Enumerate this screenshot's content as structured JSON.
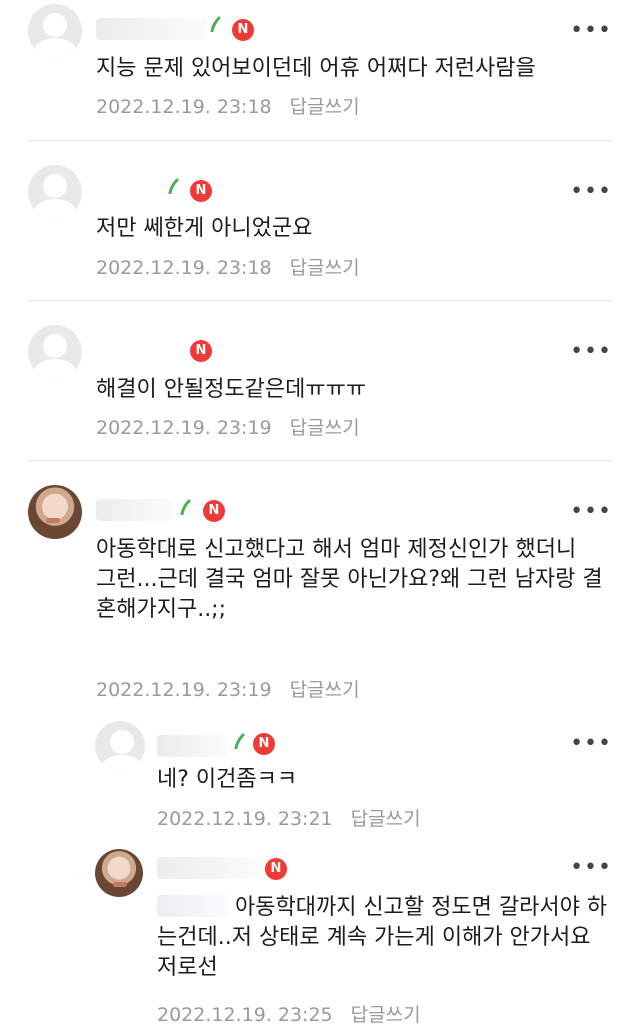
{
  "comments": [
    {
      "text": "지능 문제 있어보이던데 어휴 어쩌다 저런사람을",
      "date": "2022.12.19. 23:18",
      "reply_label": "답글쓰기",
      "badge": "N"
    },
    {
      "text": "저만 쎄한게 아니었군요",
      "date": "2022.12.19. 23:18",
      "reply_label": "답글쓰기",
      "badge": "N"
    },
    {
      "text": "해결이 안될정도같은데ㅠㅠㅠ",
      "date": "2022.12.19. 23:19",
      "reply_label": "답글쓰기",
      "badge": "N"
    },
    {
      "text": "아동학대로 신고했다고 해서 엄마 제정신인가 했더니\n그런...근데 결국 엄마 잘못 아닌가요?왜 그런 남자랑 결혼해가지구..;;",
      "date": "2022.12.19. 23:19",
      "reply_label": "답글쓰기",
      "badge": "N"
    }
  ],
  "replies": [
    {
      "text": "네? 이건좀ㅋㅋ",
      "date": "2022.12.19. 23:21",
      "reply_label": "답글쓰기",
      "badge": "N"
    },
    {
      "text": "아동학대까지 신고할 정도면 갈라서야 하는건데..저 상태로 계속 가는게 이해가 안가서요 저로선",
      "date": "2022.12.19. 23:25",
      "reply_label": "답글쓰기",
      "badge": "N"
    }
  ],
  "more_glyph": "•••",
  "icons": {
    "avatar": "default-avatar-icon",
    "sprout": "sprout-icon",
    "more": "more-options-icon"
  },
  "colors": {
    "badge": "#ef3a35",
    "sprout": "#4caf50",
    "meta": "#9a9a9a"
  }
}
